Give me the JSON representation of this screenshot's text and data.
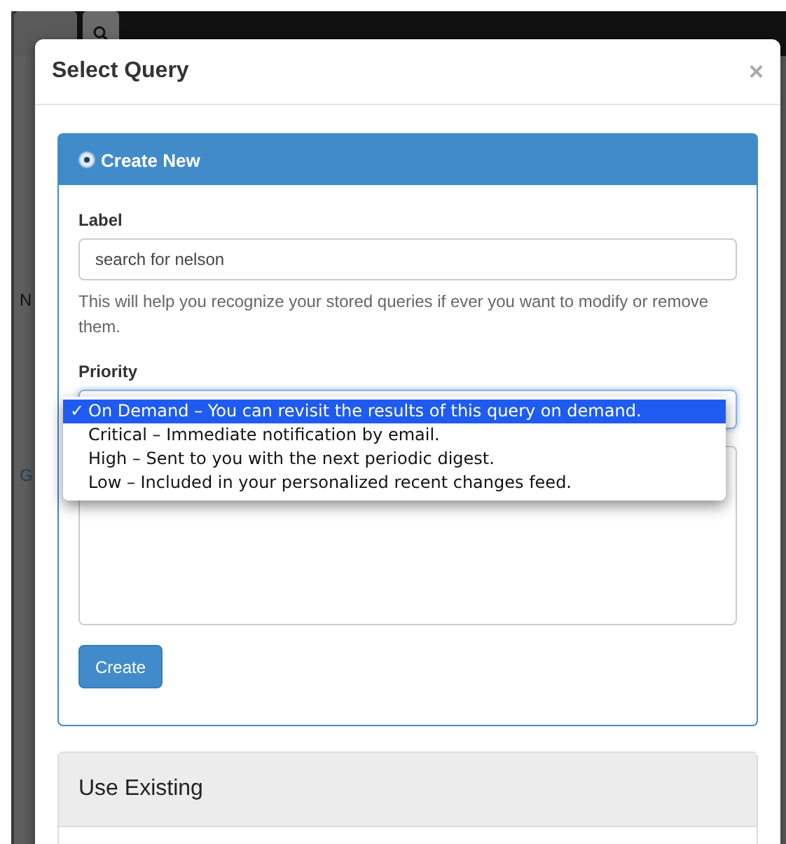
{
  "background": {
    "letters": [
      {
        "text": "N",
        "kind": "text"
      },
      {
        "text": "G",
        "kind": "link"
      }
    ]
  },
  "modal": {
    "title": "Select Query",
    "close": "×",
    "create_panel": {
      "title": "Create New",
      "selected": true,
      "label_field": {
        "label": "Label",
        "value": "search for nelson"
      },
      "help": "This will help you recognize your stored queries if ever you want to modify or remove them.",
      "priority": {
        "label": "Priority",
        "expanded": true,
        "check": "✓",
        "options": [
          {
            "text": "On Demand – You can revisit the results of this query on demand.",
            "selected": true
          },
          {
            "text": "Critical – Immediate notification by email.",
            "selected": false
          },
          {
            "text": "High – Sent to you with the next periodic digest.",
            "selected": false
          },
          {
            "text": "Low – Included in your personalized recent changes feed.",
            "selected": false
          }
        ]
      },
      "button": "Create"
    },
    "existing_panel": {
      "title": "Use Existing"
    }
  }
}
